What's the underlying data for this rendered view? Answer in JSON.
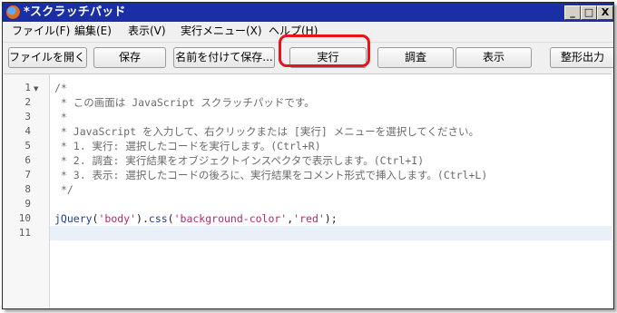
{
  "window": {
    "title": "*スクラッチパッド",
    "buttons": {
      "minimize": "_",
      "maximize": "□",
      "close": "X"
    }
  },
  "menu": [
    {
      "label": "ファイル(F)"
    },
    {
      "label": "編集(E)"
    },
    {
      "label": "表示(V)"
    },
    {
      "label": "実行メニュー(X)"
    },
    {
      "label": "ヘルプ(H)"
    }
  ],
  "toolbar": {
    "open": "ファイルを開く...",
    "save": "保存",
    "save_as": "名前を付けて保存...",
    "run": "実行",
    "inspect": "調査",
    "display": "表示",
    "pretty_print": "整形出力"
  },
  "editor": {
    "line_numbers": [
      "1",
      "2",
      "3",
      "4",
      "5",
      "6",
      "7",
      "8",
      "9",
      "10",
      "11"
    ],
    "fold_marker": "▼",
    "comment_lines": [
      "/*",
      " * この画面は JavaScript スクラッチパッドです。",
      " *",
      " * JavaScript を入力して、右クリックまたは [実行] メニューを選択してください。",
      " * 1. 実行: 選択したコードを実行します。(Ctrl+R)",
      " * 2. 調査: 実行結果をオブジェクトインスペクタで表示します。(Ctrl+I)",
      " * 3. 表示: 選択したコードの後ろに、実行結果をコメント形式で挿入します。(Ctrl+L)",
      " */"
    ],
    "code_line": {
      "fn": "jQuery",
      "p1": "(",
      "s1": "'body'",
      "p2": ").",
      "method": "css",
      "p3": "(",
      "s2": "'background-color'",
      "p4": ",",
      "s3": "'red'",
      "p5": ");"
    }
  },
  "colors": {
    "title_bar": "#1a2fa6",
    "highlight": "#e8141a",
    "string": "#b0286d",
    "function": "#1e3c9c"
  }
}
